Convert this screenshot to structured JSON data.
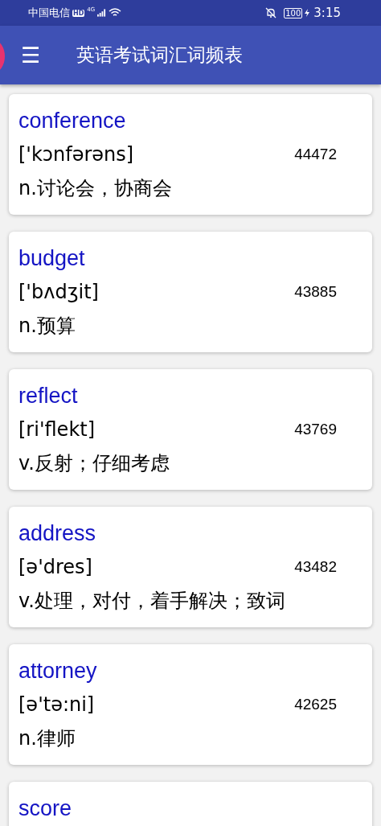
{
  "status_bar": {
    "carrier": "中国电信",
    "hd": "HD",
    "network": "4G",
    "battery": "100",
    "time": "3:15"
  },
  "app_bar": {
    "menu_icon": "☰",
    "title": "英语考试词汇词频表"
  },
  "words": [
    {
      "word": "conference",
      "phonetic": "['kɔnfərəns]",
      "count": "44472",
      "meaning": "n.讨论会，协商会"
    },
    {
      "word": "budget",
      "phonetic": "['bʌdʒit]",
      "count": "43885",
      "meaning": "n.预算"
    },
    {
      "word": "reflect",
      "phonetic": "[ri'flekt]",
      "count": "43769",
      "meaning": "v.反射；仔细考虑"
    },
    {
      "word": "address",
      "phonetic": "[ə'dres]",
      "count": "43482",
      "meaning": "v.处理，对付，着手解决；致词"
    },
    {
      "word": "attorney",
      "phonetic": "[ə'tə:ni]",
      "count": "42625",
      "meaning": "n.律师"
    },
    {
      "word": "score"
    }
  ]
}
